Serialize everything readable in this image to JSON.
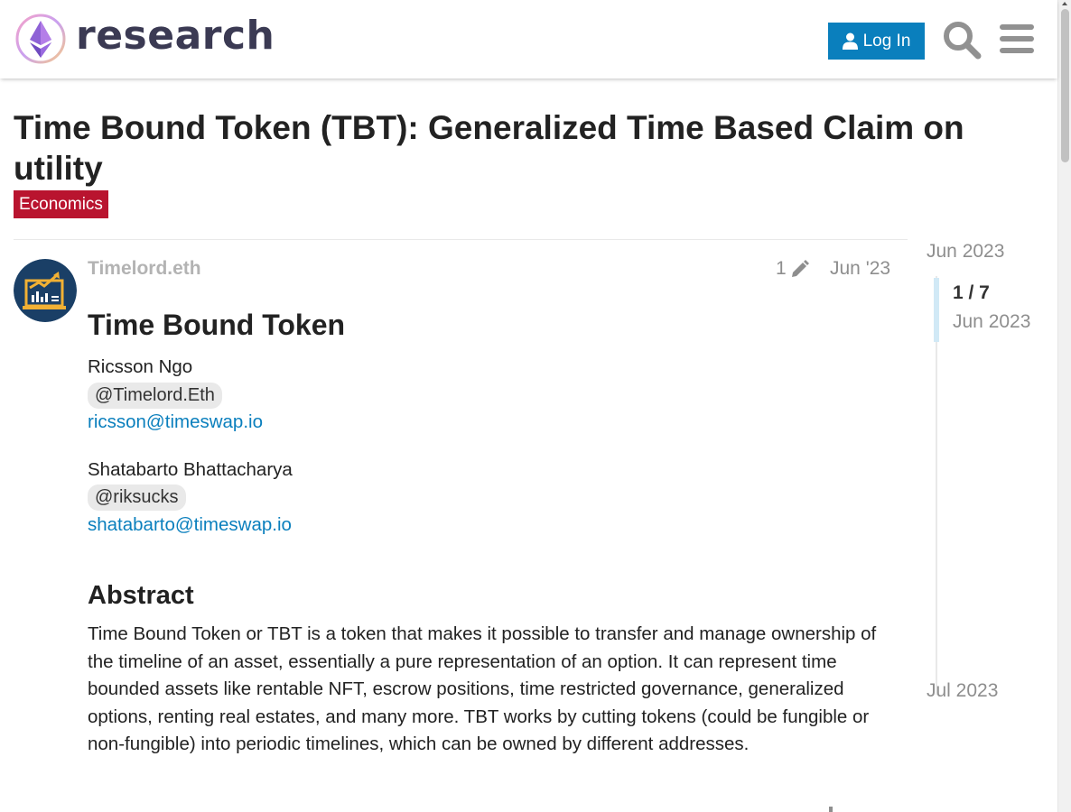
{
  "header": {
    "logo_text": "research",
    "login_label": "Log In",
    "icons": [
      "user-icon",
      "search-icon",
      "hamburger-menu-icon"
    ],
    "accent_color": "#0a7fbd"
  },
  "topic": {
    "title": "Time Bound Token (TBT): Generalized Time Based Claim on utility",
    "category": "Economics",
    "category_color": "#b9142f"
  },
  "post": {
    "username": "Timelord.eth",
    "edit_count": "1",
    "date": "Jun '23",
    "heading": "Time Bound Token",
    "authors": [
      {
        "name": "Ricsson Ngo",
        "mention": "@Timelord.Eth",
        "email": "ricsson@timeswap.io"
      },
      {
        "name": "Shatabarto Bhattacharya",
        "mention": "@riksucks",
        "email": "shatabarto@timeswap.io"
      }
    ],
    "abstract_heading": "Abstract",
    "abstract_text": "Time Bound Token or TBT is a token that makes it possible to transfer and manage ownership of the timeline of an asset, essentially a pure representation of an option. It can represent time bounded assets like rentable NFT, escrow positions, time restricted governance, generalized options, renting real estates, and many more. TBT works by cutting tokens (could be fungible or non-fungible) into periodic timelines, which can be owned by different addresses."
  },
  "timeline": {
    "start_date": "Jun 2023",
    "position": "1 / 7",
    "position_date": "Jun 2023",
    "end_date": "Jul 2023",
    "progress_fraction": 0.143
  }
}
